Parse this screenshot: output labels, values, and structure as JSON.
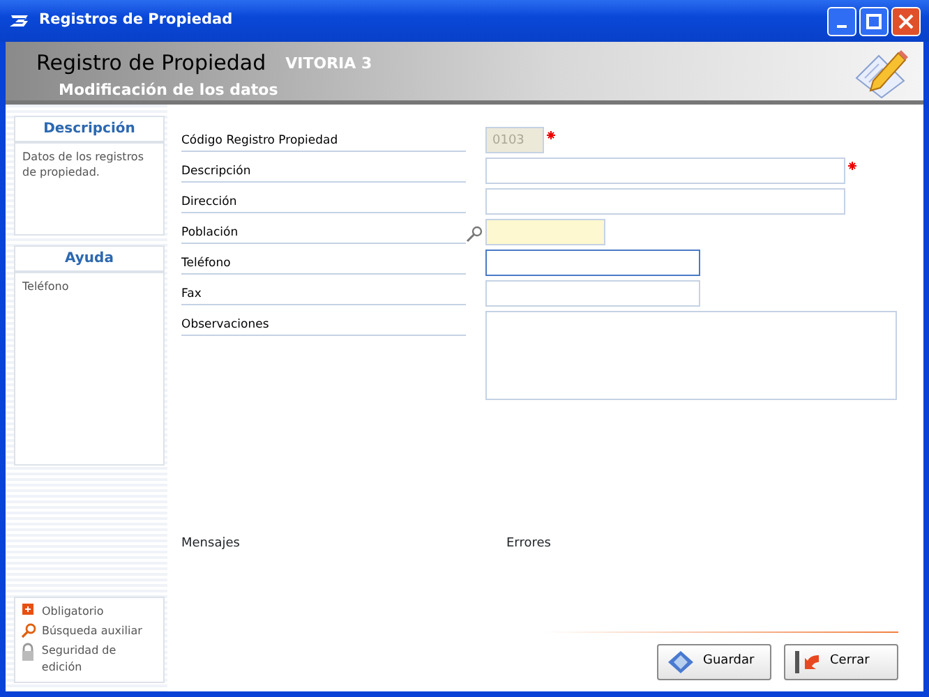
{
  "window": {
    "title": "Registros de Propiedad"
  },
  "header": {
    "title": "Registro de Propiedad",
    "app": "VITORIA 3",
    "subtitle": "Modificación de los datos"
  },
  "sidebar": {
    "panels": [
      {
        "title": "Descripción",
        "text": "Datos de los registros de propiedad."
      },
      {
        "title": "Ayuda",
        "text": "Teléfono"
      }
    ],
    "legend": [
      {
        "kind": "required",
        "label": "Obligatorio"
      },
      {
        "kind": "lookup",
        "label": "Búsqueda auxiliar"
      },
      {
        "kind": "lock",
        "label": "Seguridad de edición"
      }
    ]
  },
  "fields": [
    {
      "label": "Código Registro Propiedad",
      "kind": "code",
      "value": "0103",
      "disabled": true,
      "required": true,
      "lookup": false,
      "focused": false
    },
    {
      "label": "Descripción",
      "kind": "long",
      "disabled": false,
      "required": true,
      "lookup": false,
      "focused": false
    },
    {
      "label": "Dirección",
      "kind": "long",
      "disabled": false,
      "required": false,
      "lookup": false,
      "focused": false
    },
    {
      "label": "Población",
      "kind": "short",
      "disabled": false,
      "required": false,
      "lookup": true,
      "focused": false
    },
    {
      "label": "Teléfono",
      "kind": "medium",
      "disabled": false,
      "required": false,
      "lookup": false,
      "focused": true
    },
    {
      "label": "Fax",
      "kind": "medium",
      "disabled": false,
      "required": false,
      "lookup": false,
      "focused": false
    },
    {
      "label": "Observaciones",
      "kind": "memo",
      "disabled": false,
      "required": false,
      "lookup": false,
      "focused": false
    }
  ],
  "messages": {
    "column_1": "Mensajes",
    "column_2": "Errores"
  },
  "buttons": [
    {
      "kind": "save",
      "label": "Guardar"
    },
    {
      "kind": "close",
      "label": "Cerrar"
    }
  ]
}
